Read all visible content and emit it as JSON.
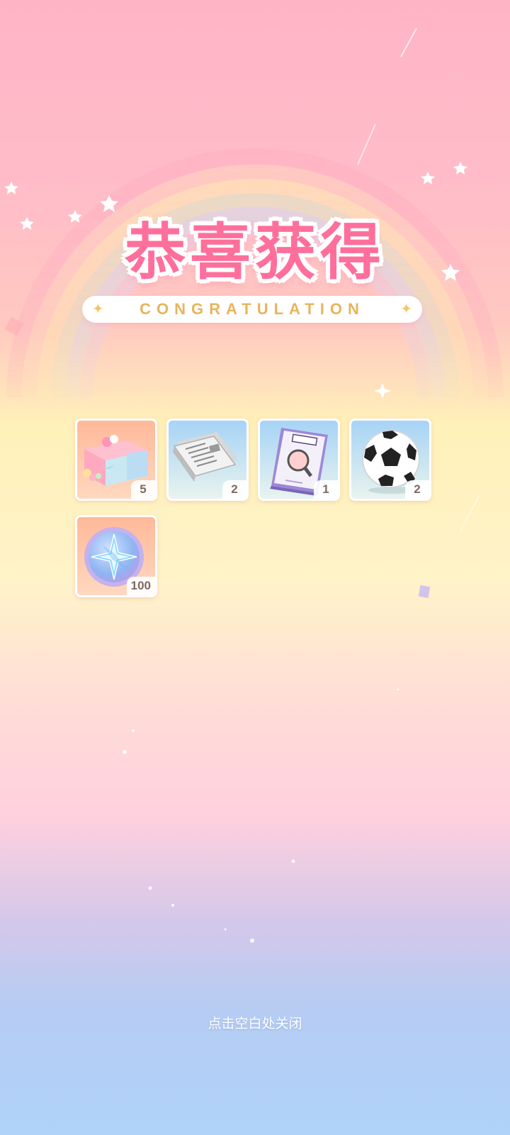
{
  "header": {
    "title_cn": "恭喜获得",
    "title_en": "CONGRATULATION"
  },
  "rewards": [
    {
      "icon": "gift-box-icon",
      "count": "5",
      "bg": "pink"
    },
    {
      "icon": "newspaper-icon",
      "count": "2",
      "bg": "blue"
    },
    {
      "icon": "magazine-icon",
      "count": "1",
      "bg": "blue"
    },
    {
      "icon": "soccer-ball-icon",
      "count": "2",
      "bg": "blue"
    },
    {
      "icon": "star-coin-icon",
      "count": "100",
      "bg": "pink"
    }
  ],
  "footer": {
    "close_hint": "点击空白处关闭"
  },
  "colors": {
    "title_pink": "#ff6f9c",
    "title_gold": "#e8b45c",
    "count_text": "#7d6a62"
  }
}
